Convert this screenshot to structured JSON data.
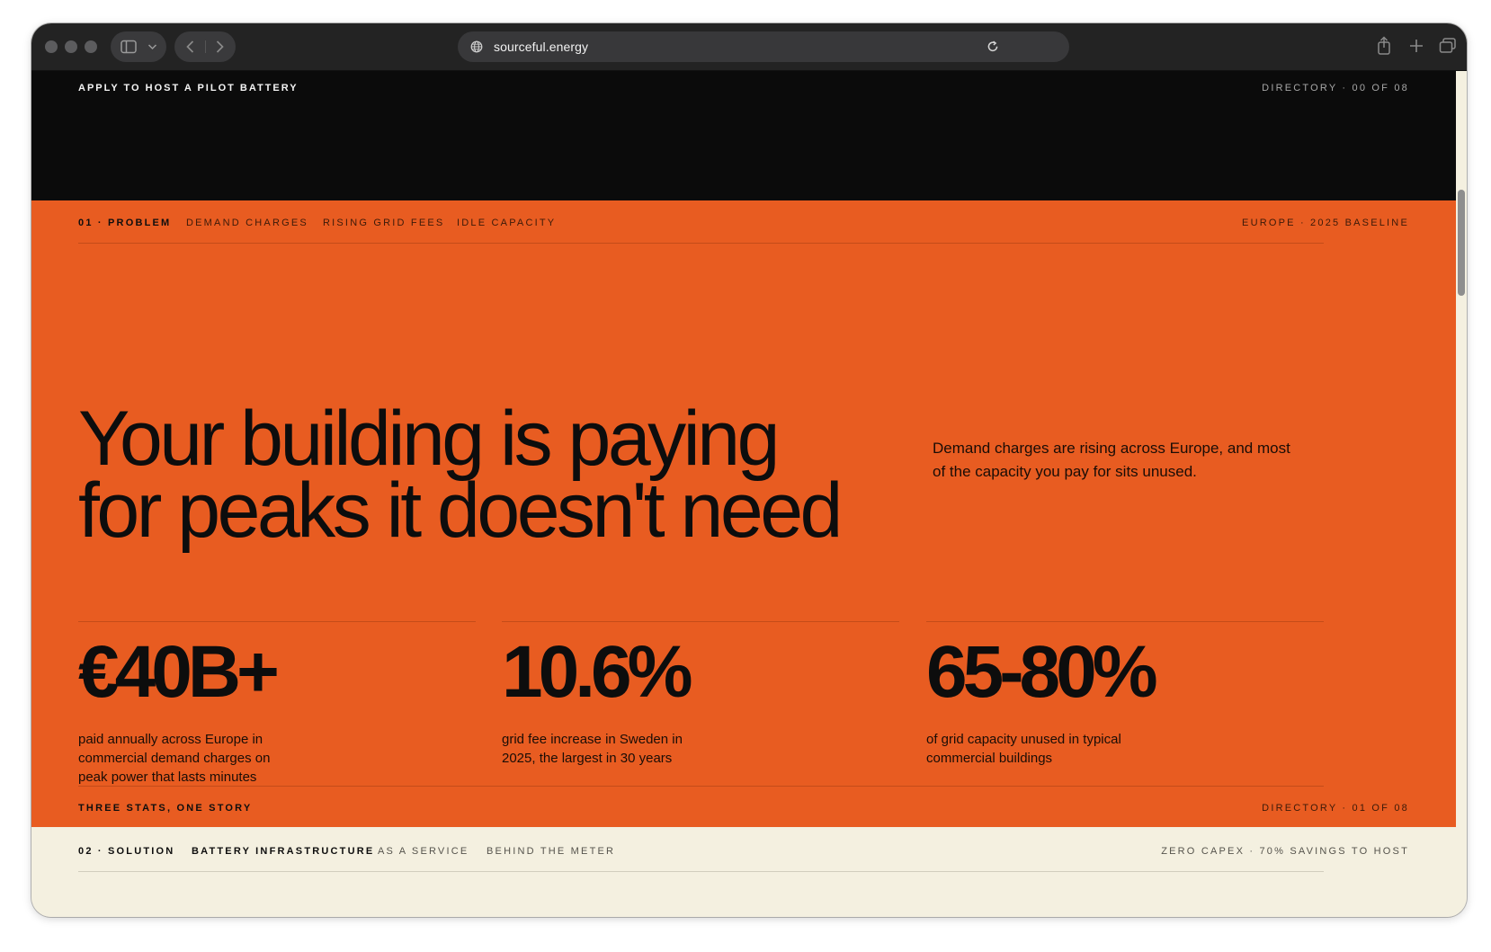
{
  "browser": {
    "url": "sourceful.energy",
    "icons": {
      "sidebar": "sidebar-icon",
      "dropdown": "chevron-down-icon",
      "back": "chevron-left-icon",
      "forward": "chevron-right-icon",
      "site": "globe-icon",
      "reload": "reload-icon",
      "share": "share-icon",
      "new_tab": "plus-icon",
      "tabs": "tab-overview-icon"
    }
  },
  "top_bar": {
    "cta": "APPLY TO HOST A PILOT BATTERY",
    "directory": "DIRECTORY · 00 OF 08"
  },
  "problem": {
    "nav": {
      "label": "01 · PROBLEM",
      "items": [
        "DEMAND CHARGES",
        "RISING GRID FEES",
        "IDLE CAPACITY"
      ],
      "meta": "EUROPE · 2025 BASELINE"
    },
    "headline_line1": "Your building is paying",
    "headline_line2": "for peaks it doesn't need",
    "lede": "Demand charges are rising across Europe, and most of the capacity you pay for sits unused.",
    "stats": [
      {
        "value": "€40B+",
        "description": "paid annually across Europe in commercial demand charges on peak power that lasts minutes"
      },
      {
        "value": "10.6%",
        "description": "grid fee increase in Sweden in 2025, the largest in 30 years"
      },
      {
        "value": "65-80%",
        "description": "of grid capacity unused in typical commercial buildings"
      }
    ],
    "footer": {
      "left": "THREE STATS, ONE STORY",
      "right": "DIRECTORY · 01 OF 08"
    }
  },
  "solution": {
    "nav": {
      "label": "02 · SOLUTION",
      "items": [
        "BATTERY INFRASTRUCTURE",
        "AS A SERVICE",
        "BEHIND THE METER"
      ],
      "meta": "ZERO CAPEX · 70% SAVINGS TO HOST"
    }
  },
  "colors": {
    "orange": "#e85c21",
    "black": "#0b0b0b",
    "cream": "#f4f0e0",
    "text": "#0d0d0d"
  }
}
